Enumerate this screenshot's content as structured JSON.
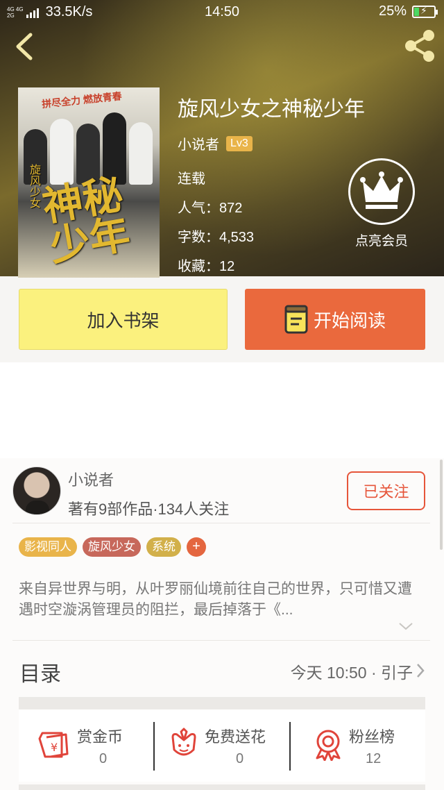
{
  "status_bar": {
    "network_top": "4G 4G",
    "network_bottom": "2G",
    "speed": "33.5K/s",
    "time": "14:50",
    "battery": "25%",
    "battery_level": 0.25
  },
  "book": {
    "title": "旋风少女之神秘少年",
    "author": "小说者",
    "level": "Lv3",
    "status": "连载",
    "popularity": "人气：872",
    "word_count": "字数：4,533",
    "favorites": "收藏：12",
    "cover": {
      "slogan": "拼尽全力 燃放青春",
      "big_text": "神秘少年",
      "small_text": "旋风少女"
    }
  },
  "vip": {
    "label": "点亮会员"
  },
  "actions": {
    "add_to_shelf": "加入书架",
    "start_reading": "开始阅读"
  },
  "author_card": {
    "name": "小说者",
    "meta": "著有9部作品·134人关注",
    "follow_label": "已关注"
  },
  "tags": [
    {
      "label": "影视同人",
      "color": "#e9b44a"
    },
    {
      "label": "旋风少女",
      "color": "#c7685b"
    },
    {
      "label": "系统",
      "color": "#d2b04a"
    }
  ],
  "tag_add_label": "+",
  "description": "来自异世界与明，从叶罗丽仙境前往自己的世界，只可惜又遭遇时空漩涡管理员的阻拦，最后掉落于《...",
  "toc": {
    "title": "目录",
    "latest": "今天 10:50 · 引子"
  },
  "rewards": [
    {
      "label": "赏金币",
      "count": "0"
    },
    {
      "label": "免费送花",
      "count": "0"
    },
    {
      "label": "粉丝榜",
      "count": "12"
    }
  ],
  "colors": {
    "accent": "#ea693d",
    "shelf": "#fbf17e",
    "follow": "#e6553a",
    "reward_icon": "#e0443a"
  }
}
